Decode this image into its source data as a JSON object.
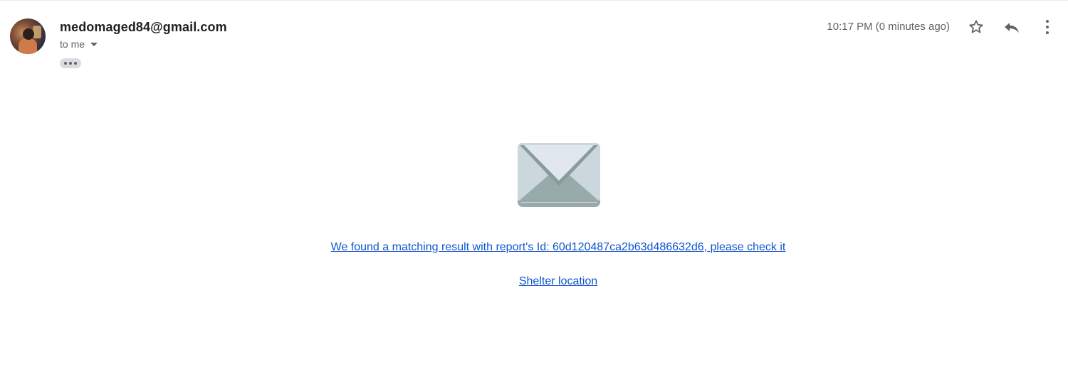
{
  "email": {
    "sender": "medomaged84@gmail.com",
    "recipient_label": "to me",
    "timestamp": "10:17 PM (0 minutes ago)"
  },
  "icons": {
    "star": "star-outline-icon",
    "reply": "reply-icon",
    "more": "more-vert-icon",
    "envelope": "envelope-icon",
    "expand": "ellipsis-icon"
  },
  "message": {
    "link_text": "We found a matching result with report's Id: 60d120487ca2b63d486632d6, please check it",
    "shelter_link_text": "Shelter location"
  },
  "colors": {
    "link": "#1155cc",
    "icon": "#5f6368"
  }
}
